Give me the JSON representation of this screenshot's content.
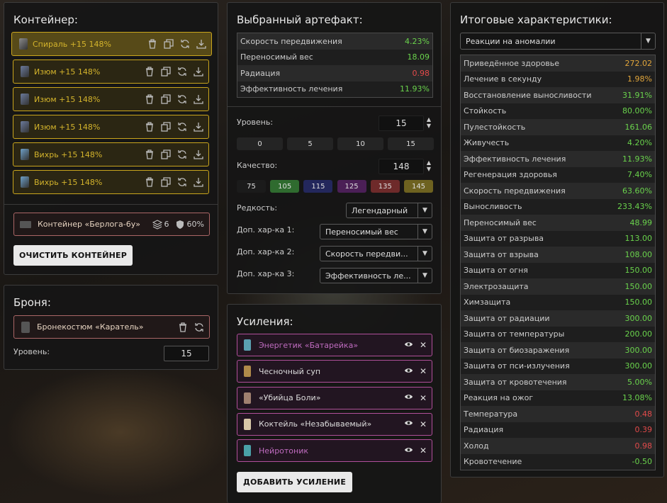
{
  "container": {
    "title": "Контейнер:",
    "artifacts": [
      {
        "name": "Спираль +15 148%",
        "color": "#8a8a8a",
        "selected": true
      },
      {
        "name": "Изюм +15 148%",
        "color": "#6b7a9b",
        "selected": false
      },
      {
        "name": "Изюм +15 148%",
        "color": "#6b7a9b",
        "selected": false
      },
      {
        "name": "Изюм +15 148%",
        "color": "#6b7a9b",
        "selected": false
      },
      {
        "name": "Вихрь +15 148%",
        "color": "#6ea0c8",
        "selected": false
      },
      {
        "name": "Вихрь +15 148%",
        "color": "#6ea0c8",
        "selected": false
      }
    ],
    "box": {
      "name": "Контейнер «Берлога-6у»",
      "slots": "6",
      "protection": "60%"
    },
    "clear_label": "ОЧИСТИТЬ КОНТЕЙНЕР"
  },
  "armor": {
    "title": "Броня:",
    "name": "Бронекостюм «Каратель»",
    "level_label": "Уровень:",
    "level": "15"
  },
  "selected": {
    "title": "Выбранный артефакт:",
    "stats": [
      {
        "name": "Скорость передвижения",
        "value": "4.23%",
        "tone": "g"
      },
      {
        "name": "Переносимый вес",
        "value": "18.09",
        "tone": "g"
      },
      {
        "name": "Радиация",
        "value": "0.98",
        "tone": "r"
      },
      {
        "name": "Эффективность лечения",
        "value": "11.93%",
        "tone": "g"
      }
    ],
    "level_label": "Уровень:",
    "level": "15",
    "level_presets": [
      "0",
      "5",
      "10",
      "15"
    ],
    "quality_label": "Качество:",
    "quality": "148",
    "quality_presets": [
      {
        "v": "75",
        "color": "#1b1b1b"
      },
      {
        "v": "105",
        "color": "#2f6b2f"
      },
      {
        "v": "115",
        "color": "#23275c"
      },
      {
        "v": "125",
        "color": "#4b1f56"
      },
      {
        "v": "135",
        "color": "#6e2a2a"
      },
      {
        "v": "145",
        "color": "#6e6220"
      }
    ],
    "rarity_label": "Редкость:",
    "rarity": "Легендарный",
    "extra1_label": "Доп. хар-ка 1:",
    "extra1": "Переносимый вес",
    "extra2_label": "Доп. хар-ка 2:",
    "extra2": "Скорость передви...",
    "extra3_label": "Доп. хар-ка 3:",
    "extra3": "Эффективность ле..."
  },
  "boosts": {
    "title": "Усиления:",
    "items": [
      {
        "name": "Энергетик «Батарейка»",
        "color": "#c06cc0",
        "icon": "#5aa0b0"
      },
      {
        "name": "Чесночный суп",
        "color": "#dddddd",
        "icon": "#b08a4a"
      },
      {
        "name": "«Убийца Боли»",
        "color": "#dddddd",
        "icon": "#a08070"
      },
      {
        "name": "Коктейль «Незабываемый»",
        "color": "#dddddd",
        "icon": "#d8c8a8"
      },
      {
        "name": "Нейротоник",
        "color": "#c06cc0",
        "icon": "#4aa0a8"
      }
    ],
    "add_label": "ДОБАВИТЬ УСИЛЕНИЕ"
  },
  "totals": {
    "title": "Итоговые характеристики:",
    "filter": "Реакции на аномалии",
    "stats": [
      {
        "name": "Приведённое здоровье",
        "value": "272.02",
        "tone": "o"
      },
      {
        "name": "Лечение в секунду",
        "value": "1.98%",
        "tone": "o"
      },
      {
        "name": "Восстановление выносливости",
        "value": "31.91%",
        "tone": "g"
      },
      {
        "name": "Стойкость",
        "value": "80.00%",
        "tone": "g"
      },
      {
        "name": "Пулестойкость",
        "value": "161.06",
        "tone": "g"
      },
      {
        "name": "Живучесть",
        "value": "4.20%",
        "tone": "g"
      },
      {
        "name": "Эффективность лечения",
        "value": "11.93%",
        "tone": "g"
      },
      {
        "name": "Регенерация здоровья",
        "value": "7.40%",
        "tone": "g"
      },
      {
        "name": "Скорость передвижения",
        "value": "63.60%",
        "tone": "g"
      },
      {
        "name": "Выносливость",
        "value": "233.43%",
        "tone": "g"
      },
      {
        "name": "Переносимый вес",
        "value": "48.99",
        "tone": "g"
      },
      {
        "name": "Защита от разрыва",
        "value": "113.00",
        "tone": "g"
      },
      {
        "name": "Защита от взрыва",
        "value": "108.00",
        "tone": "g"
      },
      {
        "name": "Защита от огня",
        "value": "150.00",
        "tone": "g"
      },
      {
        "name": "Электрозащита",
        "value": "150.00",
        "tone": "g"
      },
      {
        "name": "Химзащита",
        "value": "150.00",
        "tone": "g"
      },
      {
        "name": "Защита от радиации",
        "value": "300.00",
        "tone": "g"
      },
      {
        "name": "Защита от температуры",
        "value": "200.00",
        "tone": "g"
      },
      {
        "name": "Защита от биозаражения",
        "value": "300.00",
        "tone": "g"
      },
      {
        "name": "Защита от пси-излучения",
        "value": "300.00",
        "tone": "g"
      },
      {
        "name": "Защита от кровотечения",
        "value": "5.00%",
        "tone": "g"
      },
      {
        "name": "Реакция на ожог",
        "value": "13.08%",
        "tone": "g"
      },
      {
        "name": "Температура",
        "value": "0.48",
        "tone": "r"
      },
      {
        "name": "Радиация",
        "value": "0.39",
        "tone": "r"
      },
      {
        "name": "Холод",
        "value": "0.98",
        "tone": "r"
      },
      {
        "name": "Кровотечение",
        "value": "-0.50",
        "tone": "g"
      }
    ]
  }
}
